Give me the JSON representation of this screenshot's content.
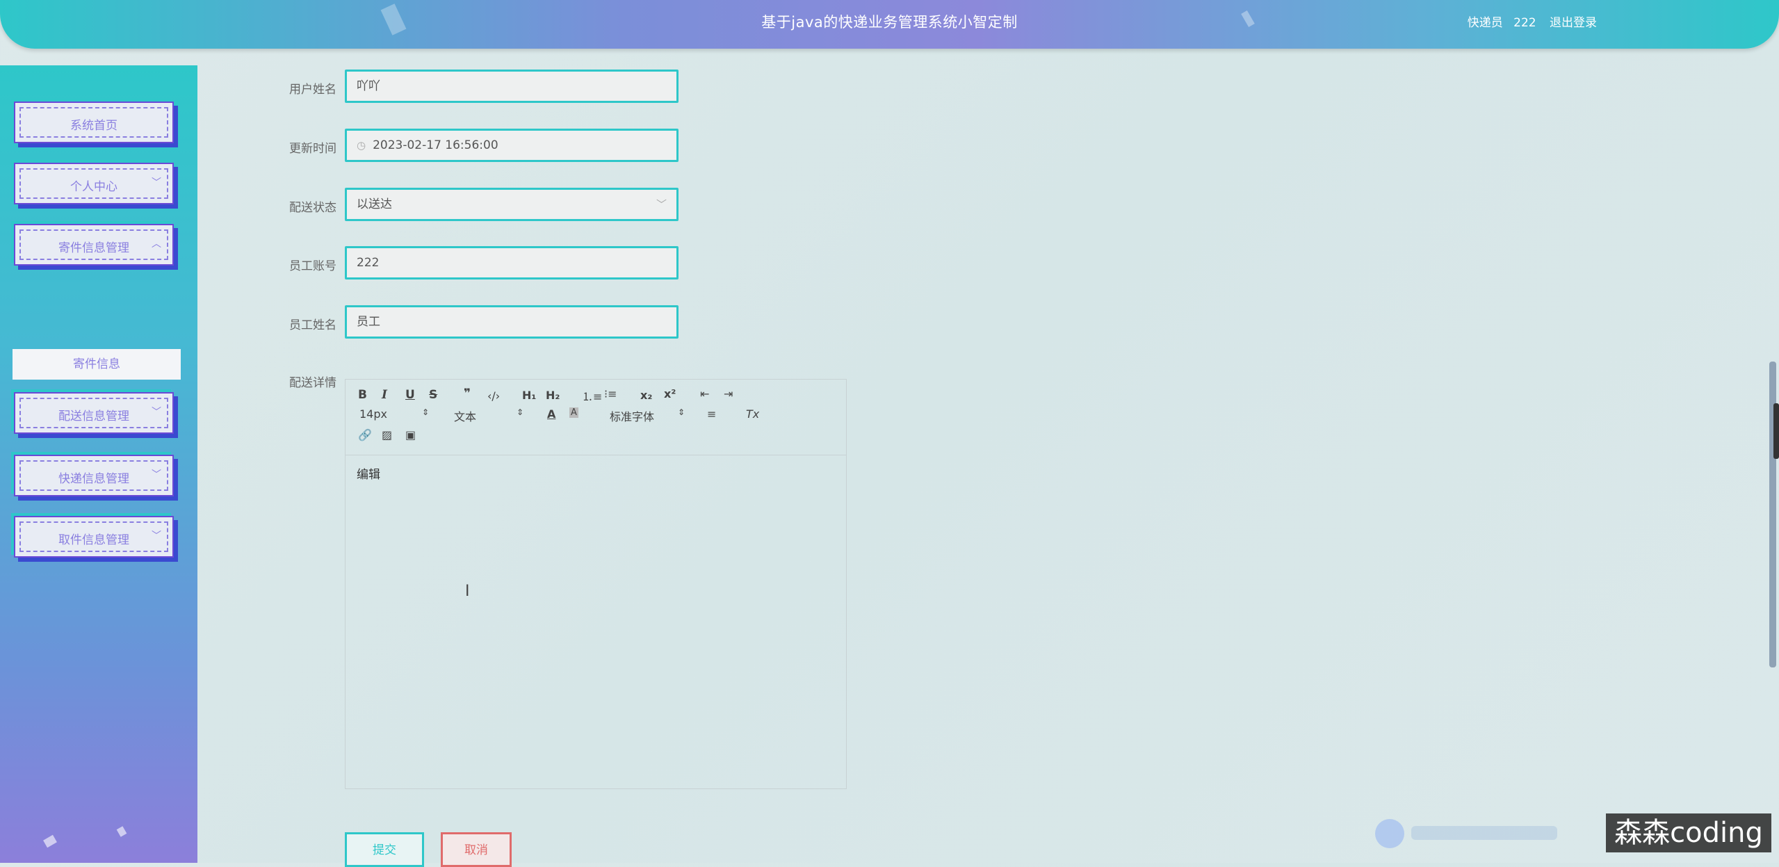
{
  "header": {
    "title": "基于java的快递业务管理系统小智定制",
    "role": "快递员",
    "username": "222",
    "logout_label": "退出登录"
  },
  "sidebar": {
    "items": [
      {
        "label": "系统首页",
        "chevron": ""
      },
      {
        "label": "个人中心",
        "chevron": "﹀"
      },
      {
        "label": "寄件信息管理",
        "chevron": "︿"
      },
      {
        "label": "配送信息管理",
        "chevron": "﹀"
      },
      {
        "label": "快递信息管理",
        "chevron": "﹀"
      },
      {
        "label": "取件信息管理",
        "chevron": "﹀"
      }
    ],
    "submenu_label": "寄件信息"
  },
  "form": {
    "user_name": {
      "label": "用户姓名",
      "value": "吖吖"
    },
    "update_time": {
      "label": "更新时间",
      "value": "2023-02-17 16:56:00"
    },
    "delivery_status": {
      "label": "配送状态",
      "value": "以送达"
    },
    "staff_account": {
      "label": "员工账号",
      "value": "222"
    },
    "staff_name": {
      "label": "员工姓名",
      "value": "员工"
    },
    "delivery_detail": {
      "label": "配送详情"
    }
  },
  "editor": {
    "font_size": "14px",
    "text_style": "文本",
    "font_family": "标准字体",
    "content": "编辑"
  },
  "buttons": {
    "submit": "提交",
    "cancel": "取消"
  },
  "watermark": "森森coding",
  "colors": {
    "accent": "#2ec7c9",
    "menu_text": "#8a7fe0",
    "cancel": "#e06b6b"
  }
}
